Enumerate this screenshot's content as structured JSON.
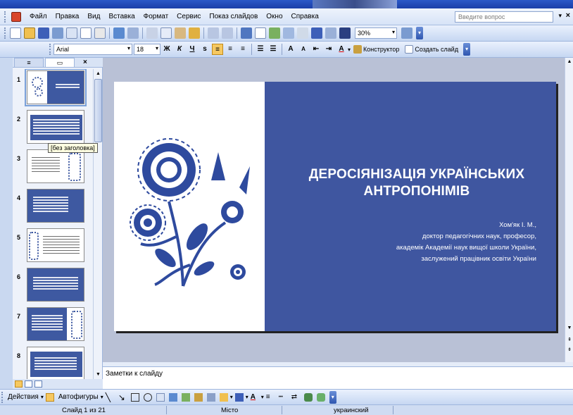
{
  "menu": {
    "items": [
      "Файл",
      "Правка",
      "Вид",
      "Вставка",
      "Формат",
      "Сервис",
      "Показ слайдов",
      "Окно",
      "Справка"
    ],
    "ask_placeholder": "Введите вопрос"
  },
  "toolbar": {
    "zoom": "30%",
    "font_name": "Arial",
    "font_size": "18",
    "designer_label": "Конструктор",
    "new_slide_label": "Создать слайд"
  },
  "slides_panel": {
    "numbers": [
      "1",
      "2",
      "3",
      "4",
      "5",
      "6",
      "7",
      "8"
    ],
    "tooltip": "[без заголовка]"
  },
  "slide": {
    "title_line1": "ДЕРОСІЯНІЗАЦІЯ УКРАЇНСЬКИХ",
    "title_line2": "АНТРОПОНІМІВ",
    "author_lines": [
      "Хом'як І. М.,",
      "доктор педагогічних наук, професор,",
      "академік Академії наук вищої школи України,",
      "заслужений працівник освіти України"
    ]
  },
  "notes": {
    "placeholder": "Заметки к слайду"
  },
  "draw_toolbar": {
    "actions_label": "Действия",
    "autoshapes_label": "Автофигуры"
  },
  "status": {
    "slide_of": "Слайд 1 из 21",
    "design": "Місто",
    "language": "украинский"
  },
  "colors": {
    "slide_blue": "#3f56a0",
    "ornament_blue": "#2e4a9e"
  }
}
